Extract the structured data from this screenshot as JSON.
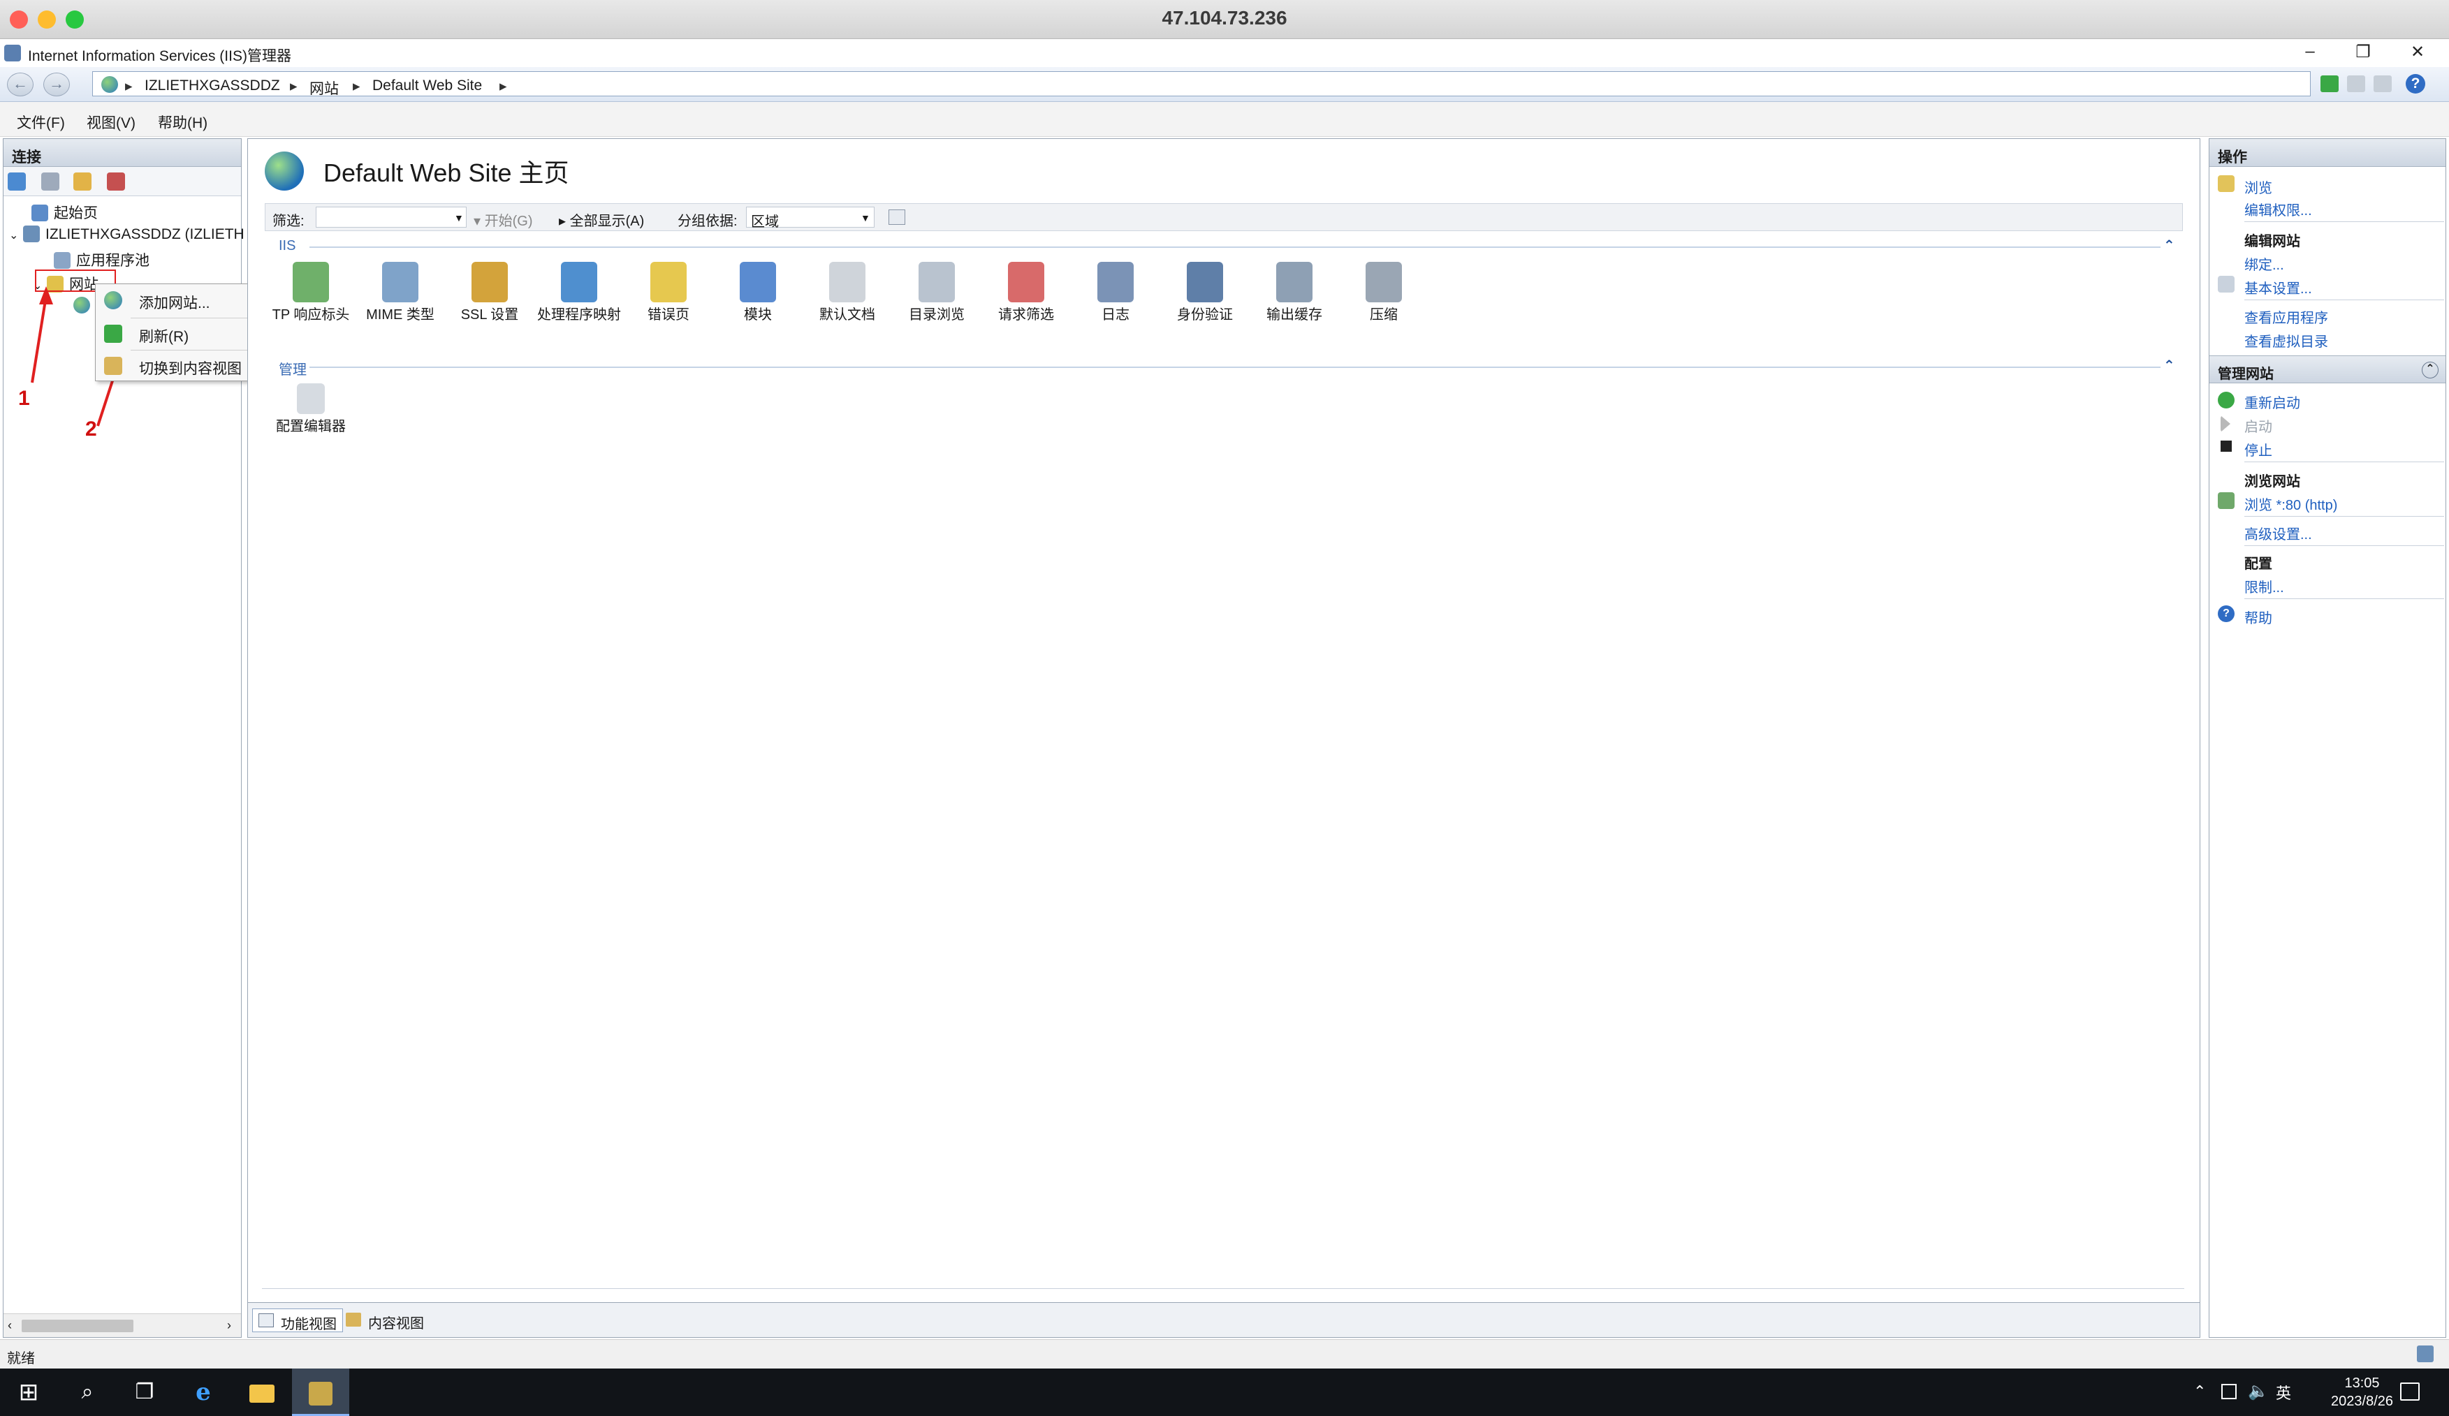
{
  "mac": {
    "title": "47.104.73.236"
  },
  "window": {
    "title": "Internet Information Services (IIS)管理器",
    "min": "–",
    "restore": "❐",
    "close": "✕"
  },
  "address": {
    "crumbs": [
      "IZLIETHXGASSDDZ",
      "网站",
      "Default Web Site"
    ],
    "sep": "▸"
  },
  "menu": [
    "文件(F)",
    "视图(V)",
    "帮助(H)"
  ],
  "left": {
    "header": "连接",
    "tree": [
      {
        "label": "起始页"
      },
      {
        "label": "IZLIETHXGASSDDZ (IZLIETH"
      },
      {
        "label": "应用程序池"
      },
      {
        "label": "网站"
      }
    ]
  },
  "context_menu": [
    "添加网站...",
    "刷新(R)",
    "切换到内容视图"
  ],
  "annotations": {
    "one": "1",
    "two": "2"
  },
  "center": {
    "title": "Default Web Site 主页",
    "filter": {
      "label": "筛选:",
      "start": "开始(G)",
      "show_all": "全部显示(A)",
      "group_by": "分组依据:",
      "group_value": "区域"
    },
    "group_iis": "IIS",
    "features": [
      "TP 响应标头",
      "MIME 类型",
      "SSL 设置",
      "处理程序映射",
      "错误页",
      "模块",
      "默认文档",
      "目录浏览",
      "请求筛选",
      "日志",
      "身份验证",
      "输出缓存",
      "压缩"
    ],
    "group_mgmt": "管理",
    "mgmt_features": [
      "配置编辑器"
    ],
    "views": {
      "feature": "功能视图",
      "content": "内容视图"
    }
  },
  "right": {
    "header": "操作",
    "browse": "浏览",
    "edit_perms": "编辑权限...",
    "edit_site": "编辑网站",
    "bindings": "绑定...",
    "basic_settings": "基本设置...",
    "view_apps": "查看应用程序",
    "view_vdirs": "查看虚拟目录",
    "manage_site": "管理网站",
    "restart": "重新启动",
    "start": "启动",
    "stop": "停止",
    "browse_site": "浏览网站",
    "browse_80": "浏览 *:80 (http)",
    "advanced": "高级设置...",
    "config": "配置",
    "limits": "限制...",
    "help": "帮助"
  },
  "status": "就绪",
  "taskbar": {
    "time": "13:05",
    "date": "2023/8/26",
    "ime": "英"
  }
}
